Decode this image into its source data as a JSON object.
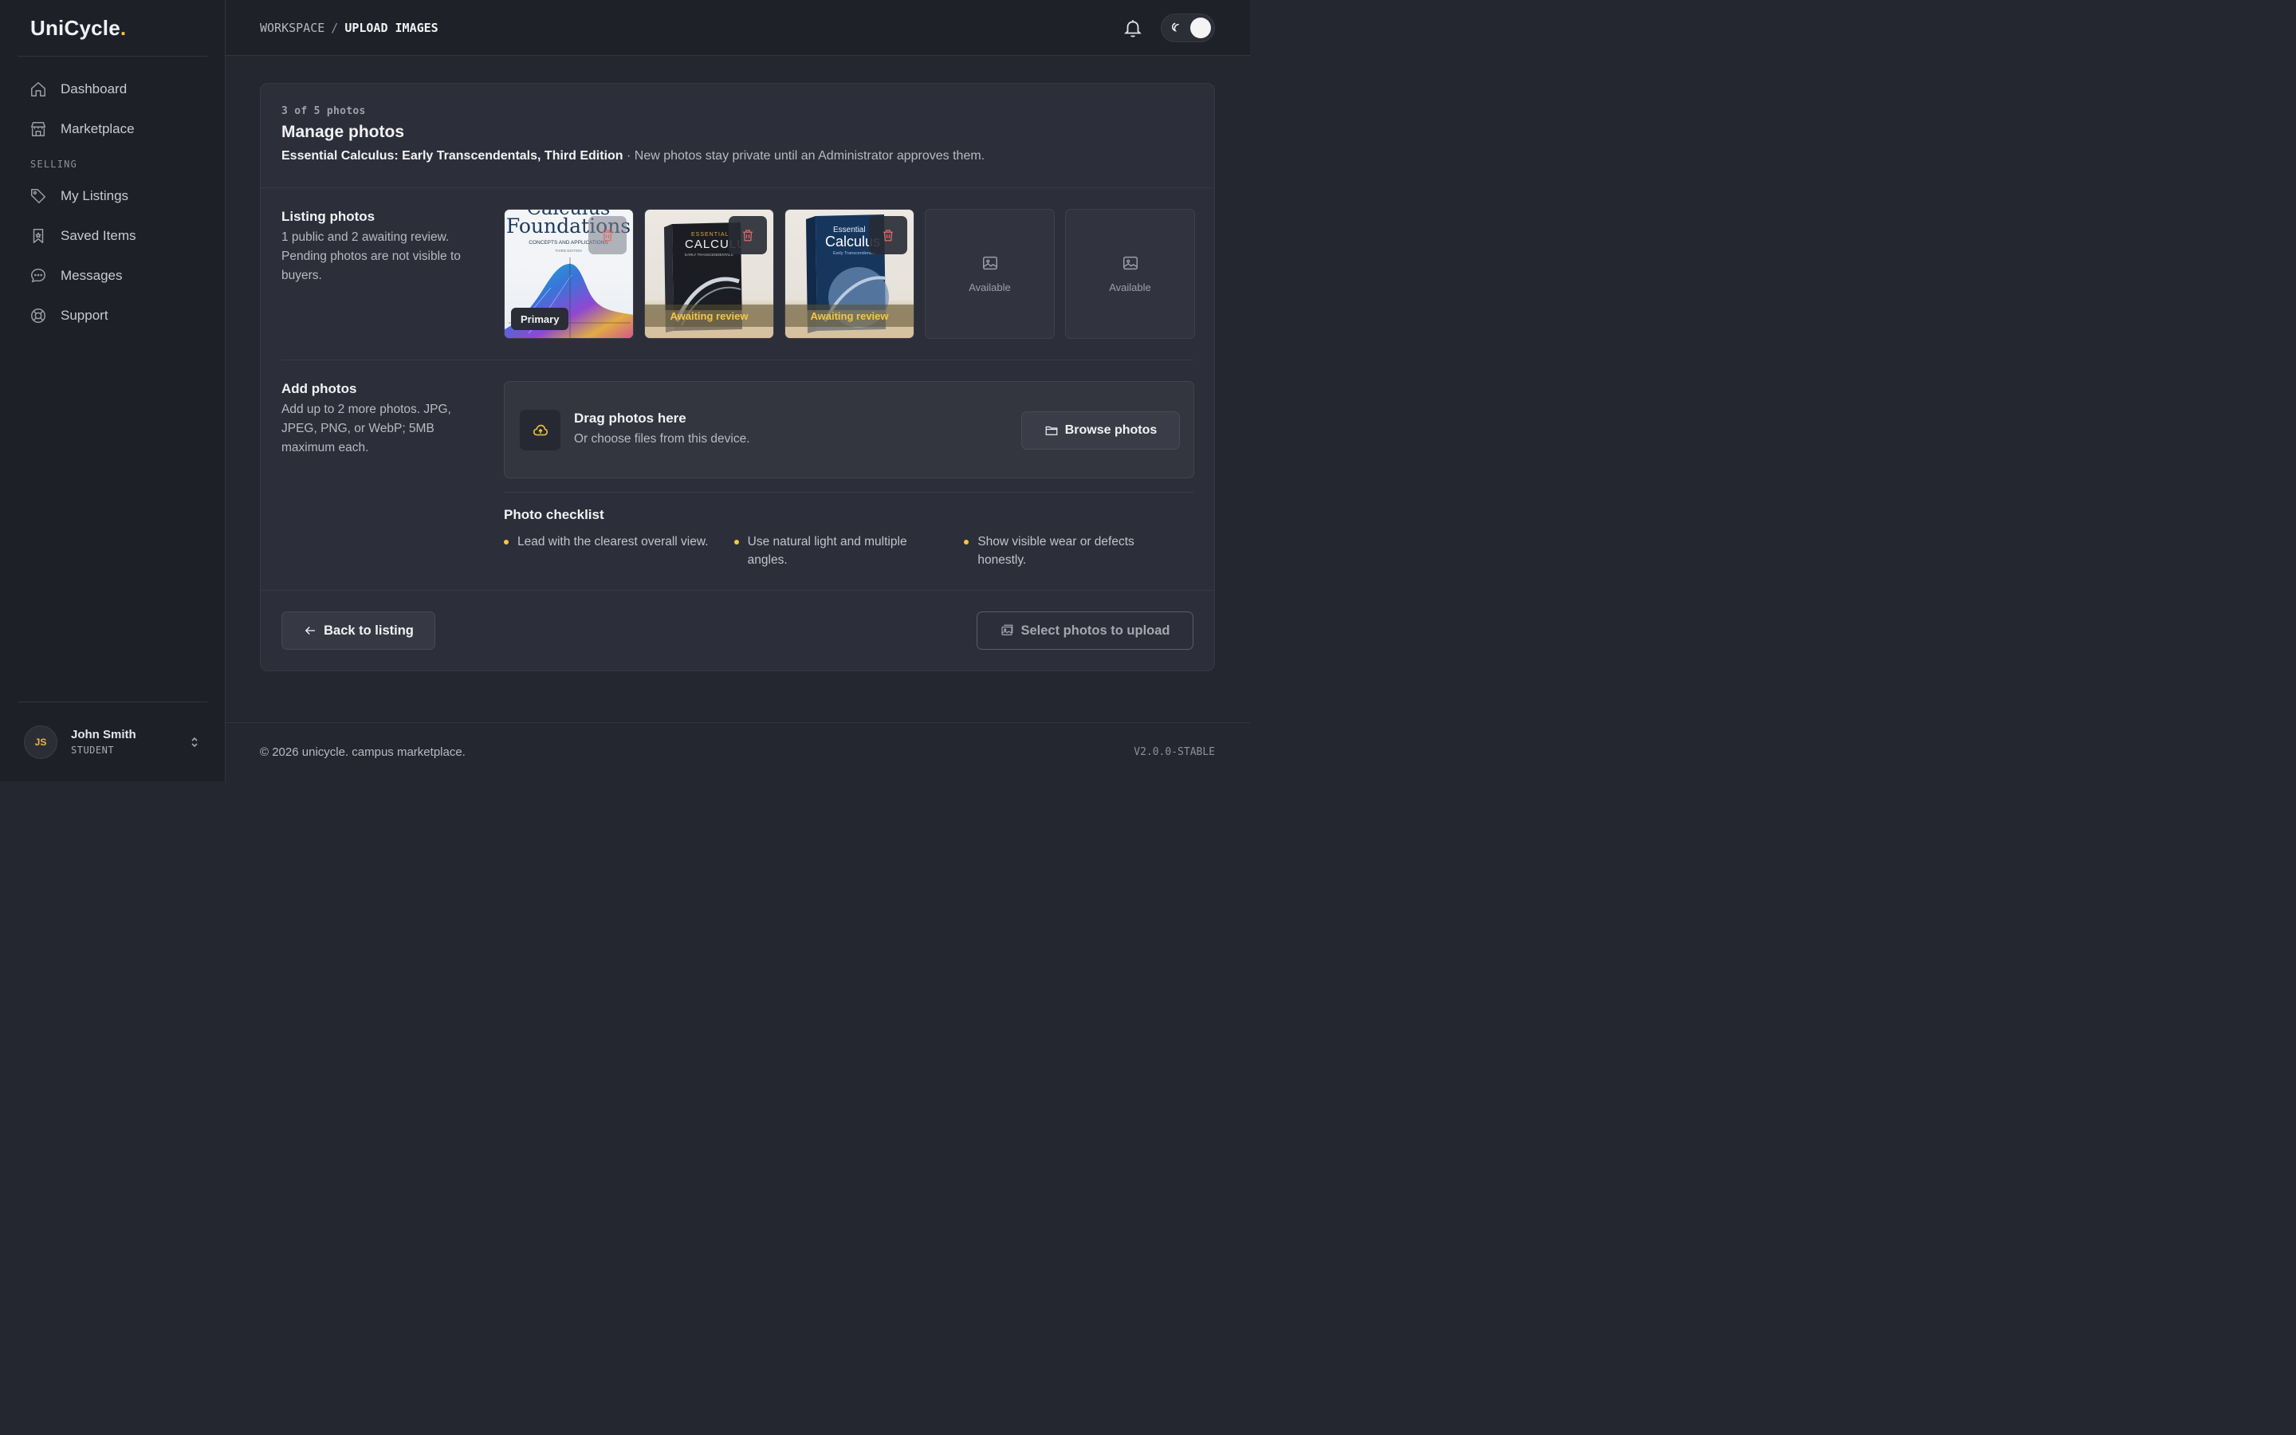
{
  "brand": {
    "name": "UniCycle",
    "dot": ".",
    "accent_color": "#f2c744"
  },
  "sidebar": {
    "items": [
      {
        "label": "Dashboard",
        "icon": "home-icon"
      },
      {
        "label": "Marketplace",
        "icon": "storefront-icon"
      }
    ],
    "section_label": "SELLING",
    "selling_items": [
      {
        "label": "My Listings",
        "icon": "tag-icon"
      },
      {
        "label": "Saved Items",
        "icon": "bookmark-icon"
      },
      {
        "label": "Messages",
        "icon": "chat-bubble-icon"
      },
      {
        "label": "Support",
        "icon": "lifebuoy-icon"
      }
    ],
    "user": {
      "initials": "JS",
      "name": "John Smith",
      "role": "STUDENT"
    }
  },
  "topbar": {
    "breadcrumb_root": "WORKSPACE",
    "breadcrumb_sep": "/",
    "breadcrumb_current": "UPLOAD IMAGES"
  },
  "card": {
    "count_label": "3 of 5 photos",
    "title": "Manage photos",
    "book_title": "Essential Calculus: Early Transcendentals, Third Edition",
    "subtitle_rest": " · New photos stay private until an Administrator approves them."
  },
  "listing_photos": {
    "title": "Listing photos",
    "description": "1 public and 2 awaiting review. Pending photos are not visible to buyers.",
    "photos": [
      {
        "status": "Primary",
        "cover_top": "Calculus",
        "cover_main": "Foundations",
        "cover_sub": "CONCEPTS AND APPLICATIONS",
        "cover_edition": "THIRD EDITION"
      },
      {
        "status": "Awaiting review",
        "cover_top": "ESSENTIAL",
        "cover_main": "CALCULUS",
        "cover_sub": "EARLY TRANSCENDENTALS"
      },
      {
        "status": "Awaiting review",
        "cover_top": "Essential",
        "cover_main": "Calculus",
        "cover_sub": "Early Transcendentals"
      }
    ],
    "empty_slots": [
      {
        "label": "Available"
      },
      {
        "label": "Available"
      }
    ]
  },
  "add_photos": {
    "title": "Add photos",
    "description": "Add up to 2 more photos. JPG, JPEG, PNG, or WebP; 5MB maximum each.",
    "drop_title": "Drag photos here",
    "drop_sub": "Or choose files from this device.",
    "browse_label": "Browse photos"
  },
  "checklist": {
    "title": "Photo checklist",
    "items": [
      "Lead with the clearest overall view.",
      "Use natural light and multiple angles.",
      "Show visible wear or defects honestly."
    ]
  },
  "actions": {
    "back_label": "Back to listing",
    "upload_label": "Select photos to upload"
  },
  "footer": {
    "copyright": "© 2026 unicycle. campus marketplace.",
    "version": "V2.0.0-STABLE"
  }
}
